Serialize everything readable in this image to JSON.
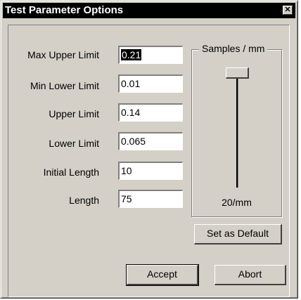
{
  "window": {
    "title": "Test Parameter Options",
    "close_glyph": "✕"
  },
  "fields": [
    {
      "label": "Max Upper Limit",
      "value": "0.21",
      "selected": true
    },
    {
      "label": "Min Lower Limit",
      "value": "0.01"
    },
    {
      "label": "Upper Limit",
      "value": "0.14"
    },
    {
      "label": "Lower Limit",
      "value": "0.065"
    },
    {
      "label": "Initial Length",
      "value": "10"
    },
    {
      "label": "Length",
      "value": "75"
    }
  ],
  "samples": {
    "group_title": "Samples / mm",
    "value_label": "20/mm",
    "slider_position": "top"
  },
  "buttons": {
    "set_default": "Set as Default",
    "accept": "Accept",
    "abort": "Abort"
  },
  "colors": {
    "face": "#d4d0c8",
    "titlebar": "#000000",
    "selection": "#000000"
  }
}
